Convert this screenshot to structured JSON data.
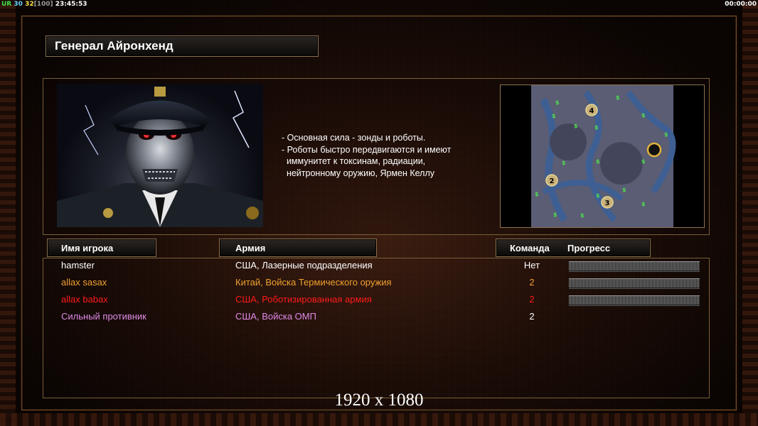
{
  "hud": {
    "fps": "UR",
    "value_a": "30",
    "value_b": "32",
    "value_c": "[100]",
    "clock": "23:45:53",
    "timer": "00:00:00"
  },
  "general": {
    "title": "Генерал Айронхенд"
  },
  "description": [
    "- Основная сила - зонды и роботы.",
    "- Роботы быстро передвигаются и имеют",
    "  иммунитет к токсинам, радиации,",
    "  нейтронному оружию, Ярмен Келлу"
  ],
  "columns": {
    "player": "Имя игрока",
    "army": "Армия",
    "team": "Команда",
    "progress": "Прогресс"
  },
  "players": [
    {
      "name": "hamster",
      "army": "США, Лазерные подразделения",
      "team": "Нет",
      "color": "#ffffff",
      "team_color": "#ffffff",
      "has_progress": true,
      "progress": 1.0
    },
    {
      "name": "allax sasax",
      "army": "Китай, Войска Термического оружия",
      "team": "2",
      "color": "#f0a030",
      "team_color": "#f0a030",
      "has_progress": true,
      "progress": 1.0
    },
    {
      "name": "allax babax",
      "army": "США, Роботизированная армия",
      "team": "2",
      "color": "#ff1a1a",
      "team_color": "#ff1a1a",
      "has_progress": true,
      "progress": 1.0
    },
    {
      "name": "Сильный противник",
      "army": "США, Войска ОМП",
      "team": "2",
      "color": "#e08ae8",
      "team_color": "#ffffff",
      "has_progress": false
    }
  ],
  "map": {
    "start_positions": [
      "4",
      "2",
      "3",
      ""
    ],
    "supply_icon": "$"
  },
  "caption": "1920 x 1080",
  "icons": {
    "general_portrait": "robot-general-portrait-icon",
    "minimap": "minimap-icon"
  }
}
